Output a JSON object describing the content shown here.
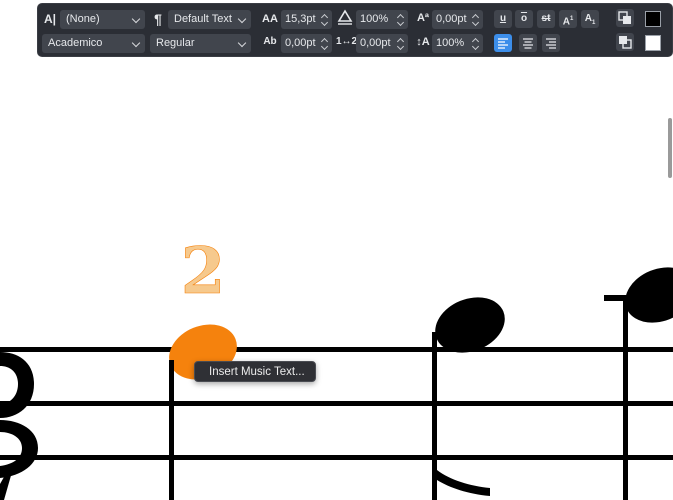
{
  "toolbar": {
    "row1": {
      "paragraph_style": "(None)",
      "text_style": "Default Text",
      "font_size": "15,3pt",
      "scale": "100%",
      "baseline": "0,00pt"
    },
    "row2": {
      "font_family": "Academico",
      "font_style": "Regular",
      "tracking": "0,00pt",
      "spacing": "0,00pt",
      "line_spacing": "100%"
    },
    "format_buttons": {
      "underline": "u",
      "overline": "o",
      "strikethrough": "st",
      "superscript": "A",
      "subscript": "A"
    },
    "colors": {
      "foreground": "#000000",
      "background": "#ffffff"
    }
  },
  "score": {
    "selected_note_color": "#f5820d",
    "fingering_label": "2",
    "fingering_color": "#f6c98d"
  },
  "context_menu": {
    "item_label": "Insert Music Text..."
  }
}
